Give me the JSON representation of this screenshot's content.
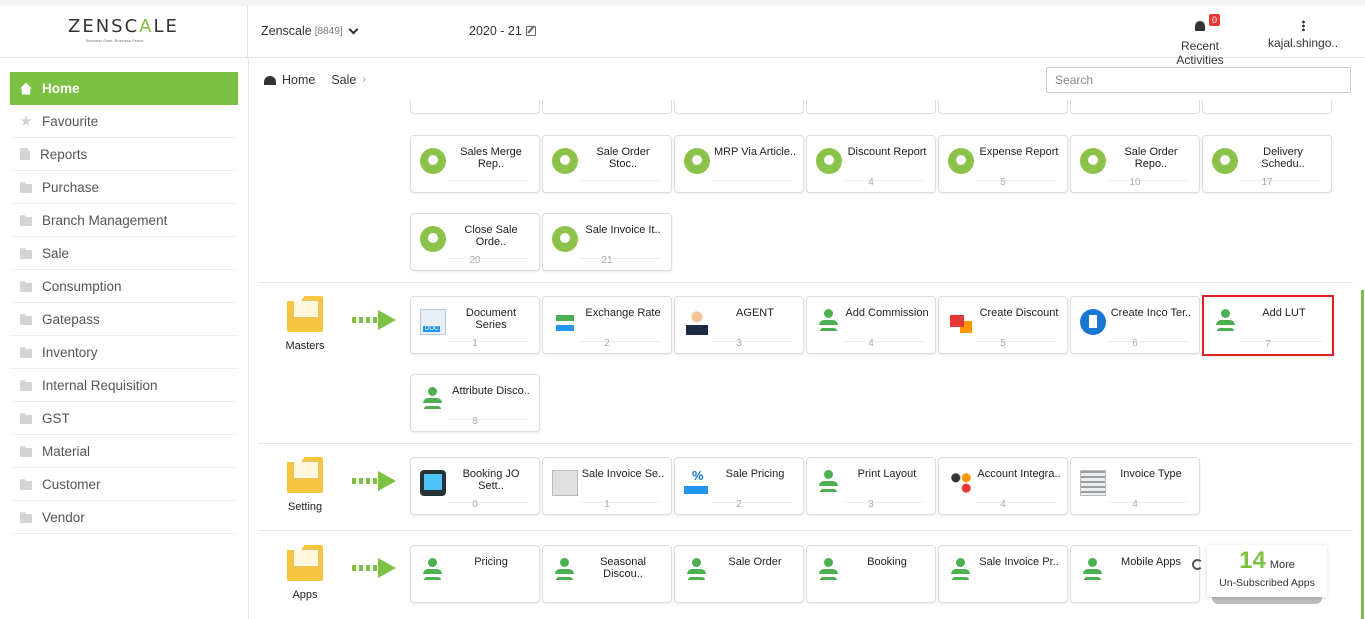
{
  "header": {
    "logo_text": "ZENSCALE",
    "logo_tagline": "Business Ease, Business Peace",
    "company": "Zenscale",
    "company_code": "[8849]",
    "financial_year": "2020 - 21",
    "recent_activities_label": "Recent Activities",
    "notification_count": "0",
    "user_name": "kajal.shingo.."
  },
  "sidebar": {
    "items": [
      {
        "label": "Home",
        "icon": "home-icon"
      },
      {
        "label": "Favourite",
        "icon": "star-icon"
      },
      {
        "label": "Reports",
        "icon": "document-icon"
      },
      {
        "label": "Purchase",
        "icon": "folder-icon"
      },
      {
        "label": "Branch Management",
        "icon": "folder-icon"
      },
      {
        "label": "Sale",
        "icon": "folder-icon"
      },
      {
        "label": "Consumption",
        "icon": "folder-icon"
      },
      {
        "label": "Gatepass",
        "icon": "folder-icon"
      },
      {
        "label": "Inventory",
        "icon": "folder-icon"
      },
      {
        "label": "Internal Requisition",
        "icon": "folder-icon"
      },
      {
        "label": "GST",
        "icon": "folder-icon"
      },
      {
        "label": "Material",
        "icon": "folder-icon"
      },
      {
        "label": "Customer",
        "icon": "folder-icon"
      },
      {
        "label": "Vendor",
        "icon": "folder-icon"
      }
    ]
  },
  "breadcrumb": {
    "home": "Home",
    "current": "Sale"
  },
  "search": {
    "placeholder": "Search"
  },
  "reports_row1": [
    {
      "title": "Sales Merge Rep..",
      "num": ""
    },
    {
      "title": "Sale Order Stoc..",
      "num": ""
    },
    {
      "title": "MRP Via Article..",
      "num": ""
    },
    {
      "title": "Discount Report",
      "num": "4"
    },
    {
      "title": "Expense Report",
      "num": "5"
    },
    {
      "title": "Sale Order Repo..",
      "num": "10"
    },
    {
      "title": "Delivery Schedu..",
      "num": "17"
    }
  ],
  "reports_row2": [
    {
      "title": "Close Sale Orde..",
      "num": "20"
    },
    {
      "title": "Sale Invoice It..",
      "num": "21"
    }
  ],
  "masters": {
    "label": "Masters",
    "row1": [
      {
        "title": "Document Series",
        "num": "1"
      },
      {
        "title": "Exchange Rate",
        "num": "2"
      },
      {
        "title": "AGENT",
        "num": "3"
      },
      {
        "title": "Add Commission",
        "num": "4"
      },
      {
        "title": "Create Discount",
        "num": "5"
      },
      {
        "title": "Create Inco Ter..",
        "num": "6"
      },
      {
        "title": "Add LUT",
        "num": "7"
      }
    ],
    "row2": [
      {
        "title": "Attribute Disco..",
        "num": "8"
      }
    ]
  },
  "setting": {
    "label": "Setting",
    "row1": [
      {
        "title": "Booking JO Sett..",
        "num": "0"
      },
      {
        "title": "Sale Invoice Se..",
        "num": "1"
      },
      {
        "title": "Sale Pricing",
        "num": "2"
      },
      {
        "title": "Print Layout",
        "num": "3"
      },
      {
        "title": "Account Integra..",
        "num": "4"
      },
      {
        "title": "Invoice Type",
        "num": "4"
      }
    ]
  },
  "apps": {
    "label": "Apps",
    "row1": [
      {
        "title": "Pricing"
      },
      {
        "title": "Seasonal Discou.."
      },
      {
        "title": "Sale Order"
      },
      {
        "title": "Booking"
      },
      {
        "title": "Sale Invoice Pr.."
      },
      {
        "title": "Mobile Apps"
      }
    ],
    "more_count": "14",
    "more_word": "More",
    "more_sub": "Un-Subscribed Apps"
  },
  "colors": {
    "accent": "#7cc142",
    "selected_border": "#e02020"
  }
}
